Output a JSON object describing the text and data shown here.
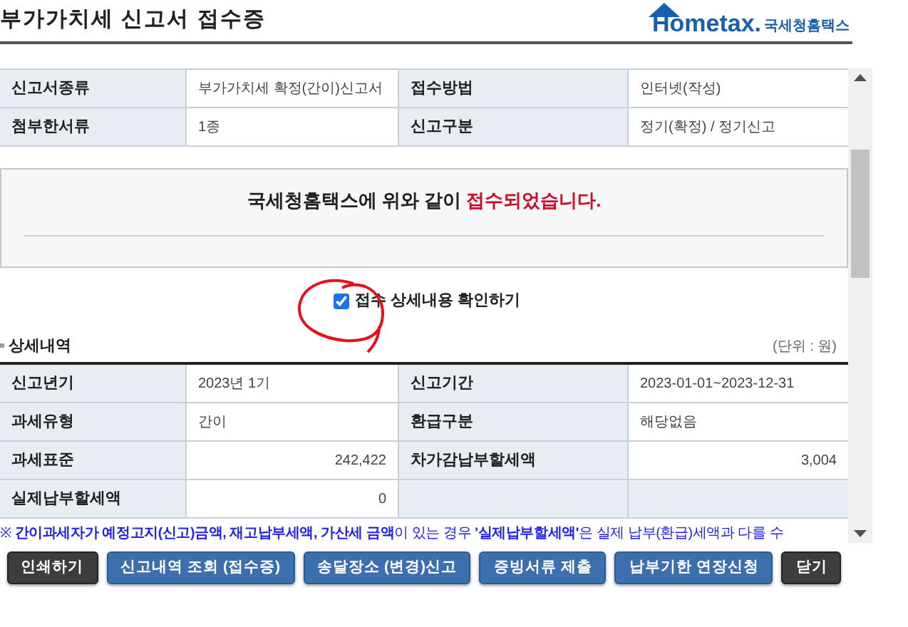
{
  "header": {
    "title": "부가가치세 신고서 접수증",
    "logo": {
      "brand": "Hometax.",
      "sub": "국세청홈택스"
    }
  },
  "summary": {
    "rows": [
      [
        {
          "label": "신고서종류",
          "value": "부가가치세 확정(간이)신고서"
        },
        {
          "label": "접수방법",
          "value": "인터넷(작성)"
        }
      ],
      [
        {
          "label": "첨부한서류",
          "value": "1종"
        },
        {
          "label": "신고구분",
          "value": "정기(확정) / 정기신고"
        }
      ]
    ]
  },
  "message": {
    "text": "국세청홈택스에 위와 같이",
    "highlight": "접수되었습니다."
  },
  "detail_toggle": {
    "label": "접수 상세내용 확인하기",
    "checked": true
  },
  "details": {
    "title": "상세내역",
    "unit": "(단위 : 원)",
    "rows": [
      [
        {
          "label": "신고년기",
          "value": "2023년 1기",
          "kind": "text"
        },
        {
          "label": "신고기간",
          "value": "2023-01-01~2023-12-31",
          "kind": "text"
        }
      ],
      [
        {
          "label": "과세유형",
          "value": "간이",
          "kind": "text"
        },
        {
          "label": "환급구분",
          "value": "해당없음",
          "kind": "text"
        }
      ],
      [
        {
          "label": "과세표준",
          "value": "242,422",
          "kind": "amount"
        },
        {
          "label": "차가감납부할세액",
          "value": "3,004",
          "kind": "amount"
        }
      ],
      [
        {
          "label": "실제납부할세액",
          "value": "0",
          "kind": "amount"
        }
      ]
    ]
  },
  "note": "※ **간이과세자가 예정고지(신고)금액, 재고납부세액, 가산세 금액**이 있는 경우 **'실제납부할세액'**은 실제 납부(환급)세액과 다를 수",
  "buttons": [
    {
      "label": "인쇄하기",
      "kind": "dark"
    },
    {
      "label": "신고내역 조회 (접수증)",
      "kind": "blue"
    },
    {
      "label": "송달장소 (변경)신고",
      "kind": "blue"
    },
    {
      "label": "증빙서류 제출",
      "kind": "blue"
    },
    {
      "label": "납부기한 연장신청",
      "kind": "blue"
    },
    {
      "label": "닫기",
      "kind": "dark"
    }
  ]
}
